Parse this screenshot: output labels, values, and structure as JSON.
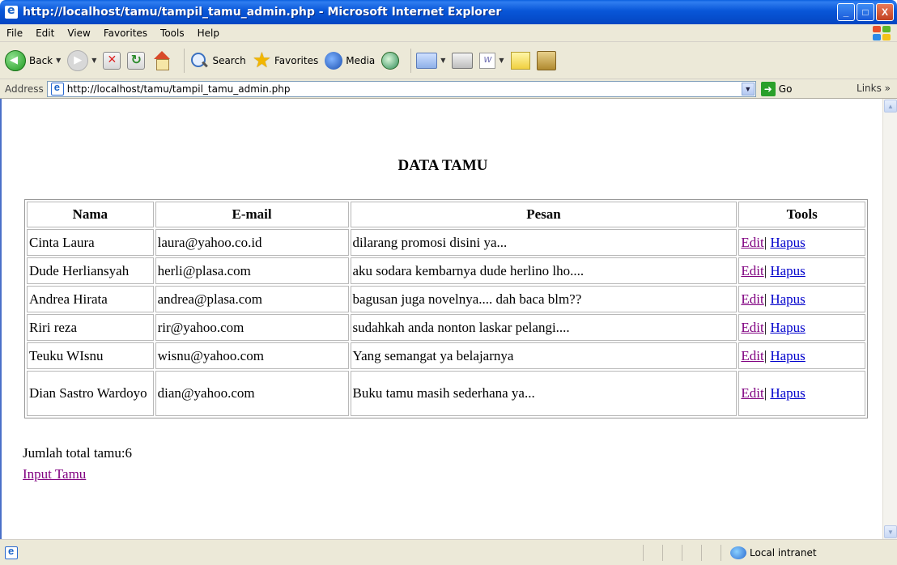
{
  "window": {
    "title": "http://localhost/tamu/tampil_tamu_admin.php - Microsoft Internet Explorer",
    "controls": {
      "minimize": "_",
      "maximize": "□",
      "close": "X"
    }
  },
  "menubar": {
    "items": [
      "File",
      "Edit",
      "View",
      "Favorites",
      "Tools",
      "Help"
    ]
  },
  "toolbar": {
    "back_label": "Back",
    "search_label": "Search",
    "favorites_label": "Favorites",
    "media_label": "Media",
    "word_glyph": "W"
  },
  "addressbar": {
    "label": "Address",
    "url": "http://localhost/tamu/tampil_tamu_admin.php",
    "go_label": "Go",
    "links_label": "Links »"
  },
  "page": {
    "title": "DATA TAMU",
    "table": {
      "headers": [
        "Nama",
        "E-mail",
        "Pesan",
        "Tools"
      ],
      "rows": [
        {
          "nama": "Cinta Laura",
          "email": "laura@yahoo.co.id",
          "pesan": "dilarang promosi disini ya...",
          "edit": "Edit",
          "sep": "|",
          "hapus": "Hapus"
        },
        {
          "nama": "Dude Herliansyah",
          "email": "herli@plasa.com",
          "pesan": "aku sodara kembarnya dude herlino lho....",
          "edit": "Edit",
          "sep": "|",
          "hapus": "Hapus"
        },
        {
          "nama": "Andrea Hirata",
          "email": "andrea@plasa.com",
          "pesan": "bagusan juga novelnya.... dah baca blm??",
          "edit": "Edit",
          "sep": "|",
          "hapus": "Hapus"
        },
        {
          "nama": "Riri reza",
          "email": "rir@yahoo.com",
          "pesan": "sudahkah anda nonton laskar pelangi....",
          "edit": "Edit",
          "sep": "|",
          "hapus": "Hapus"
        },
        {
          "nama": "Teuku WIsnu",
          "email": "wisnu@yahoo.com",
          "pesan": "Yang semangat ya belajarnya",
          "edit": "Edit",
          "sep": "|",
          "hapus": "Hapus"
        },
        {
          "nama": "Dian Sastro Wardoyo",
          "email": "dian@yahoo.com",
          "pesan": "Buku tamu masih sederhana ya...",
          "edit": "Edit",
          "sep": "|",
          "hapus": "Hapus"
        }
      ]
    },
    "total_label": "Jumlah total tamu:",
    "total_value": "6",
    "input_link": "Input Tamu"
  },
  "statusbar": {
    "zone": "Local intranet"
  },
  "colors": {
    "titlebar": "#0a5fe0",
    "link": "#0000cc",
    "visited": "#800080",
    "chrome": "#ece9d8"
  }
}
